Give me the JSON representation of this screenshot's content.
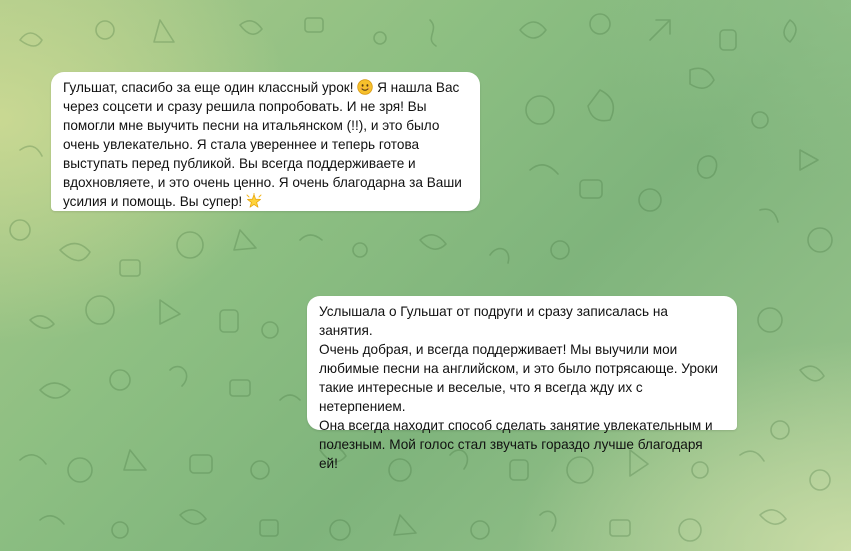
{
  "chat": {
    "messages": [
      {
        "text_1": "Гульшат, спасибо за еще один классный урок! ",
        "emoji_1": "smiling-face-emoji",
        "text_2": " Я нашла Вас\nчерез соцсети и сразу решила попробовать. И не зря! Вы\nпомогли мне выучить песни на итальянском (!!), и это было\nочень увлекательно. Я стала увереннее и теперь готова\nвыступать перед публикой. Вы всегда поддерживаете и\nвдохновляете, и это очень ценно. Я очень благодарна за Ваши\nусилия и помощь. Вы супер! ",
        "emoji_2": "glowing-star-emoji"
      },
      {
        "text": "Услышала о Гульшат от подруги и сразу записалась на занятия.\nОчень добрая, и всегда поддерживает! Мы выучили мои\nлюбимые песни на английском, и это было потрясающе. Уроки\nтакие интересные и веселые, что я всегда жду их с нетерпением.\nОна всегда находит способ сделать занятие увлекательным и\nполезным. Мой голос стал звучать гораздо лучше благодаря ей!"
      }
    ]
  }
}
